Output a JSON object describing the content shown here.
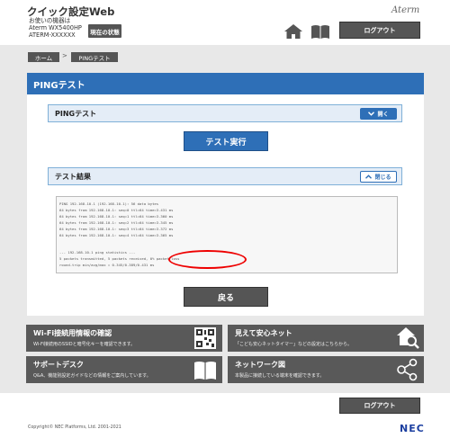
{
  "header": {
    "app_title": "クイック設定Web",
    "device_caption": "お使いの機器は",
    "device_model": "Aterm WX5400HP",
    "device_id": "ATERM-XXXXXX",
    "status_button": "現在の状態",
    "brand": "Aterm",
    "logout": "ログアウト",
    "home_icon": "home-icon",
    "manual_icon": "book-icon"
  },
  "breadcrumb": {
    "home": "ホーム",
    "separator": ">",
    "current": "PINGテスト"
  },
  "page": {
    "title": "PINGテスト"
  },
  "ping_panel": {
    "title": "PINGテスト",
    "toggle": "開く",
    "run_button": "テスト実行"
  },
  "result_panel": {
    "title": "テスト結果",
    "toggle": "閉じる",
    "lines": [
      "PING 192.168.10.1 (192.168.10.1): 56 data bytes",
      "64 bytes from 192.168.10.1: seq=0 ttl=64 time=3.431 ms",
      "64 bytes from 192.168.10.1: seq=1 ttl=64 time=3.360 ms",
      "64 bytes from 192.168.10.1: seq=2 ttl=64 time=3.345 ms",
      "64 bytes from 192.168.10.1: seq=3 ttl=64 time=3.372 ms",
      "64 bytes from 192.168.10.1: seq=4 ttl=64 time=3.365 ms",
      "",
      "--- 192.168.10.1 ping statistics ---",
      "5 packets transmitted, 5 packets received, 0% packet loss",
      "round-trip min/avg/max = 0.345/0.389/0.431 ms"
    ],
    "highlight": "0% packet loss"
  },
  "back_button": "戻る",
  "tiles": [
    {
      "title": "Wi-Fi接続用情報の確認",
      "desc": "Wi-Fi接続用のSSIDと暗号化キーを確認できます。",
      "icon": "qr-code-icon"
    },
    {
      "title": "見えて安心ネット",
      "desc": "「こども安心ネットタイマー」などの設定はこちらから。",
      "icon": "home-search-icon"
    },
    {
      "title": "サポートデスク",
      "desc": "Q&A、機能別設定ガイドなどの情報をご案内しています。",
      "icon": "book-icon"
    },
    {
      "title": "ネットワーク図",
      "desc": "本製品に接続している端末を確認できます。",
      "icon": "network-icon"
    }
  ],
  "footer": {
    "logout": "ログアウト",
    "copyright": "Copyright© NEC Platforms, Ltd. 2001-2021",
    "brand": "NEC"
  },
  "colors": {
    "accent_blue": "#2e6fb7",
    "dark_gray": "#555555",
    "body_gray": "#e8e8e8",
    "highlight_red": "#e00000"
  }
}
